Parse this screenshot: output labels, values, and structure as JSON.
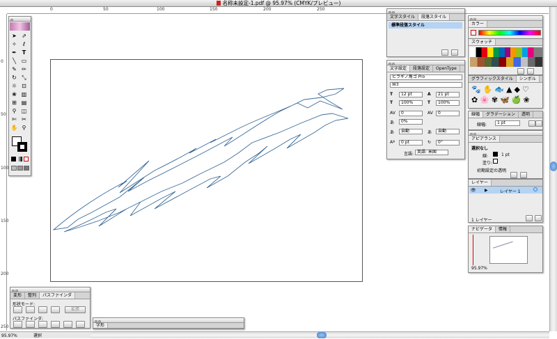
{
  "window": {
    "title": "名称未設定-1.pdf @ 95.97% (CMYK/プレビュー)"
  },
  "ruler": {
    "top_labels": [
      "0",
      "50",
      "100",
      "150",
      "200",
      "250"
    ],
    "left_labels": [
      "0",
      "50",
      "100",
      "150",
      "200",
      "250"
    ]
  },
  "status": {
    "zoom": "95.97%",
    "tool": "選択"
  },
  "char_style_panel": {
    "tabs": [
      "文字スタイル",
      "段落スタイル"
    ],
    "item": "標準段落スタイル"
  },
  "character_panel": {
    "tabs": [
      "文字設定",
      "段落設定",
      "OpenType"
    ],
    "font_family": "ヒラギノ角ゴ Pro",
    "font_style": "W3",
    "size": "12 pt",
    "leading": "21 pt",
    "hscale": "100%",
    "vscale": "100%",
    "kerning": "0",
    "tracking": "0",
    "tsume": "0%",
    "aki_left": "自動",
    "aki_right": "自動",
    "baseline": "0 pt",
    "rotation": "0°",
    "language_label": "言語:",
    "language": "英語: 米国"
  },
  "color_panel": {
    "tabs": [
      "カラー"
    ]
  },
  "swatch_panel": {
    "tabs": [
      "スウォッチ"
    ]
  },
  "graphic_style_panel": {
    "tabs": [
      "グラフィックスタイル",
      "シンボル"
    ]
  },
  "stroke_panel": {
    "tabs": [
      "線幅",
      "グラデーション",
      "透明"
    ],
    "label": "線幅:",
    "value": "1 pt"
  },
  "appearance_panel": {
    "tabs": [
      "アピアランス"
    ],
    "header": "選択なし",
    "stroke_label": "線:",
    "stroke_value": "1 pt",
    "fill_label": "塗り:",
    "default_transparency": "初期設定の透明"
  },
  "layers_panel": {
    "tabs": [
      "レイヤー"
    ],
    "layer_name": "レイヤー 1",
    "footer": "1 レイヤー"
  },
  "navigator_panel": {
    "tabs": [
      "ナビゲータ",
      "情報"
    ],
    "zoom": "95.97%"
  },
  "pathfinder_panel": {
    "tabs": [
      "変形",
      "整列",
      "パスファインダ"
    ],
    "shape_modes_label": "形状モード:",
    "expand_label": "拡張",
    "pathfinders_label": "パスファインダ:"
  },
  "text_panel": {
    "tabs": [
      "字形"
    ]
  },
  "tools": [
    "selection-tool",
    "direct-selection-tool",
    "magic-wand-tool",
    "lasso-tool",
    "pen-tool",
    "type-tool",
    "line-tool",
    "rectangle-tool",
    "paintbrush-tool",
    "pencil-tool",
    "rotate-tool",
    "scale-tool",
    "warp-tool",
    "free-transform-tool",
    "symbol-sprayer-tool",
    "graph-tool",
    "mesh-tool",
    "gradient-tool",
    "eyedropper-tool",
    "blend-tool",
    "slice-tool",
    "scissors-tool",
    "hand-tool",
    "zoom-tool"
  ],
  "colors": {
    "stroke_path": "#3a6a98",
    "selection_blue": "#b5d3f3",
    "accent_blue": "#3f7fcf"
  }
}
